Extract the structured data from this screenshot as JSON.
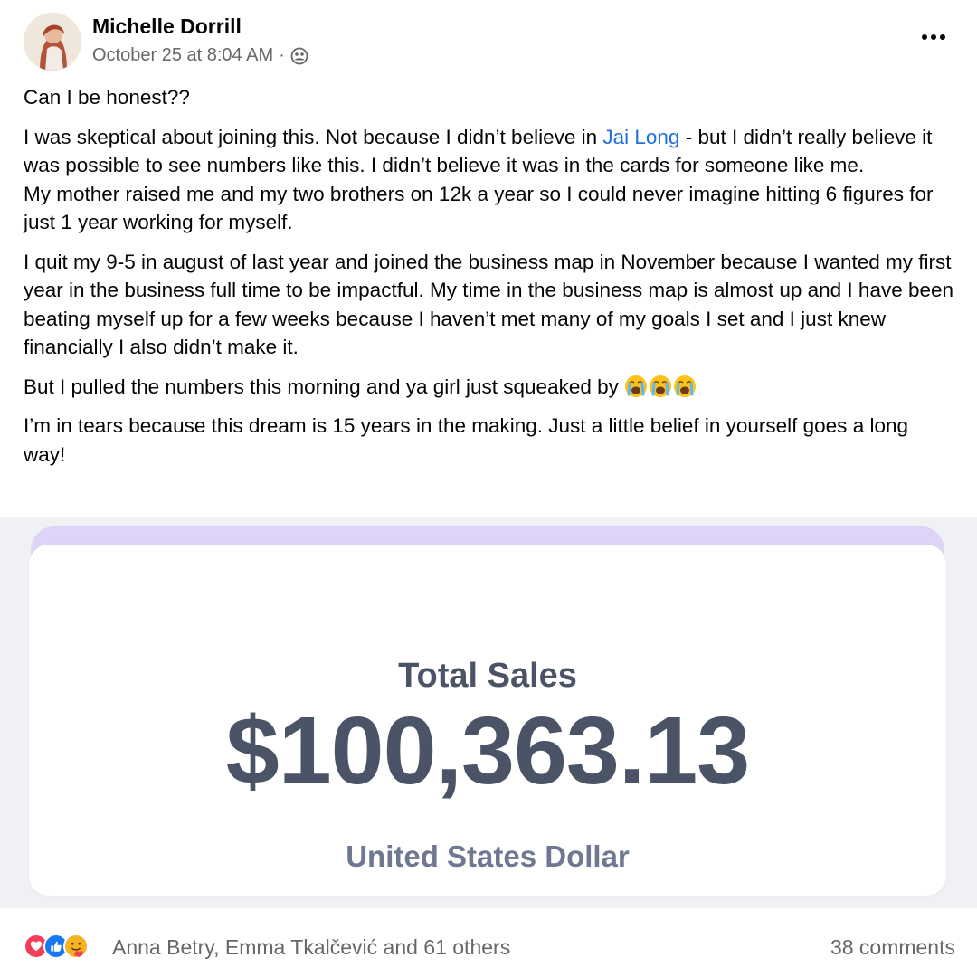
{
  "post": {
    "author": "Michelle Dorrill",
    "timestamp": "October 25 at 8:04 AM",
    "separator": "·",
    "audience_icon": "group-icon",
    "more_icon": "more-options-icon",
    "paragraphs": {
      "p1": "Can I be honest??",
      "p2_before": "I was skeptical about joining this. Not because I didn’t believe in ",
      "p2_mention": "Jai Long",
      "p2_after": " - but I didn’t really believe it was possible to see numbers like this. I didn’t believe it was in the cards for someone like me.",
      "p2_line2": "My mother raised me and my two brothers on 12k a year so I could never imagine hitting 6 figures for just 1 year working for myself.",
      "p3": "I quit my 9-5 in august of last year and joined the business map in November because I wanted my first year in the business full time to be impactful. My time in the business map is almost up and I have been beating myself up for a few weeks because I haven’t met many of my goals I set and I just knew financially I also didn’t make it.",
      "p4": "But I pulled the numbers this morning and ya girl just squeaked by",
      "p4_emojis": [
        "loudly-crying-face-icon",
        "loudly-crying-face-icon",
        "loudly-crying-face-icon"
      ],
      "p5": "I’m in tears because this dream is 15 years in the making. Just a little belief in yourself goes a long way!"
    }
  },
  "sales_card": {
    "title": "Total Sales",
    "value": "$100,363.13",
    "currency": "United States Dollar"
  },
  "footer": {
    "reactions": [
      "love-icon",
      "like-icon",
      "care-icon"
    ],
    "reaction_names": "Anna Betry, Emma Tkalčević and 61 others",
    "comments": "38 comments"
  },
  "colors": {
    "link": "#216fdb",
    "secondary_text": "#65676b",
    "card_text": "#4a5466",
    "card_strip": "#ddd4f7"
  }
}
